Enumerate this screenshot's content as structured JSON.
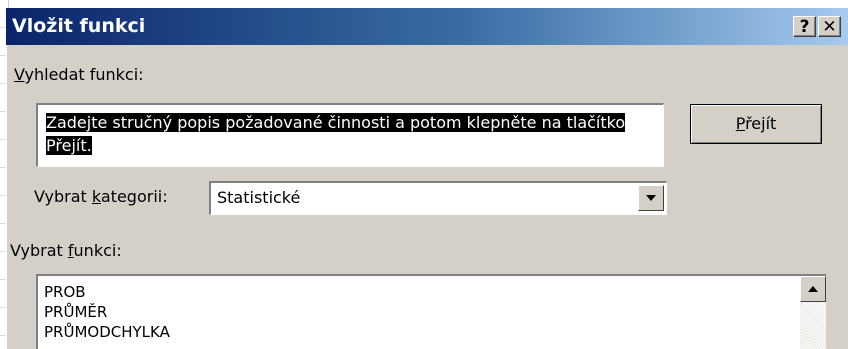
{
  "window": {
    "title": "Vložit funkci",
    "help_label": "?",
    "close_label": "✕"
  },
  "search": {
    "label_prefix": "",
    "label_accel": "V",
    "label_rest": "yhledat funkci:",
    "value": "Zadejte stručný popis požadované činnosti a potom klepněte na tlačítko Přejít.",
    "go_accel": "P",
    "go_rest": "řejít"
  },
  "category": {
    "label_prefix": "Vybrat ",
    "label_accel": "k",
    "label_rest": "ategorii:",
    "selected": "Statistické"
  },
  "functions": {
    "label_prefix": "Vybrat ",
    "label_accel": "f",
    "label_rest": "unkci:",
    "items": [
      "PROB",
      "PRŮMĚR",
      "PRŮMODCHYLKA"
    ]
  },
  "colors": {
    "title_start": "#0a246a",
    "title_end": "#a6caf0",
    "dialog_face": "#d4d0c8"
  },
  "icons": {
    "help": "question-icon",
    "close": "close-icon",
    "dropdown": "chevron-down-icon",
    "scroll_up": "arrow-up-icon"
  }
}
